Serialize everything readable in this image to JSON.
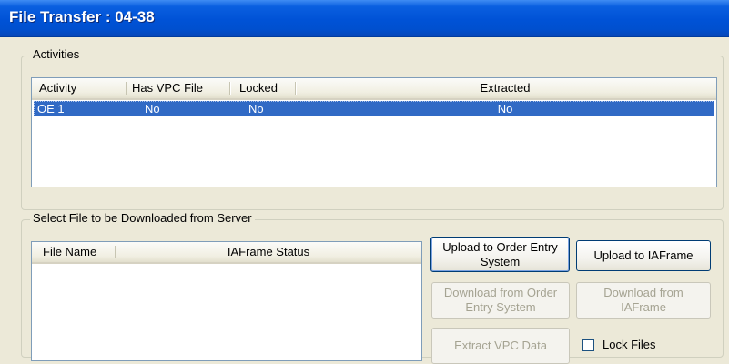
{
  "window": {
    "title": "File Transfer : 04-38"
  },
  "activities": {
    "legend": "Activities",
    "columns": [
      "Activity",
      "Has VPC File",
      "Locked",
      "Extracted"
    ],
    "rows": [
      {
        "activity": "OE 1",
        "has_vpc_file": "No",
        "locked": "No",
        "extracted": "No"
      }
    ]
  },
  "download": {
    "legend": "Select File to be Downloaded from Server",
    "columns": [
      "File Name",
      "IAFrame Status"
    ],
    "rows": []
  },
  "buttons": {
    "upload_oe": "Upload to Order Entry System",
    "upload_iaframe": "Upload to IAFrame",
    "download_oe": "Download from Order Entry System",
    "download_iaframe": "Download from IAFrame",
    "extract_vpc": "Extract VPC Data"
  },
  "lock_files": {
    "label": "Lock Files",
    "checked": false
  },
  "colors": {
    "title_bar": "#0052d6",
    "selection": "#316ac5",
    "window_bg": "#ece9d8"
  }
}
